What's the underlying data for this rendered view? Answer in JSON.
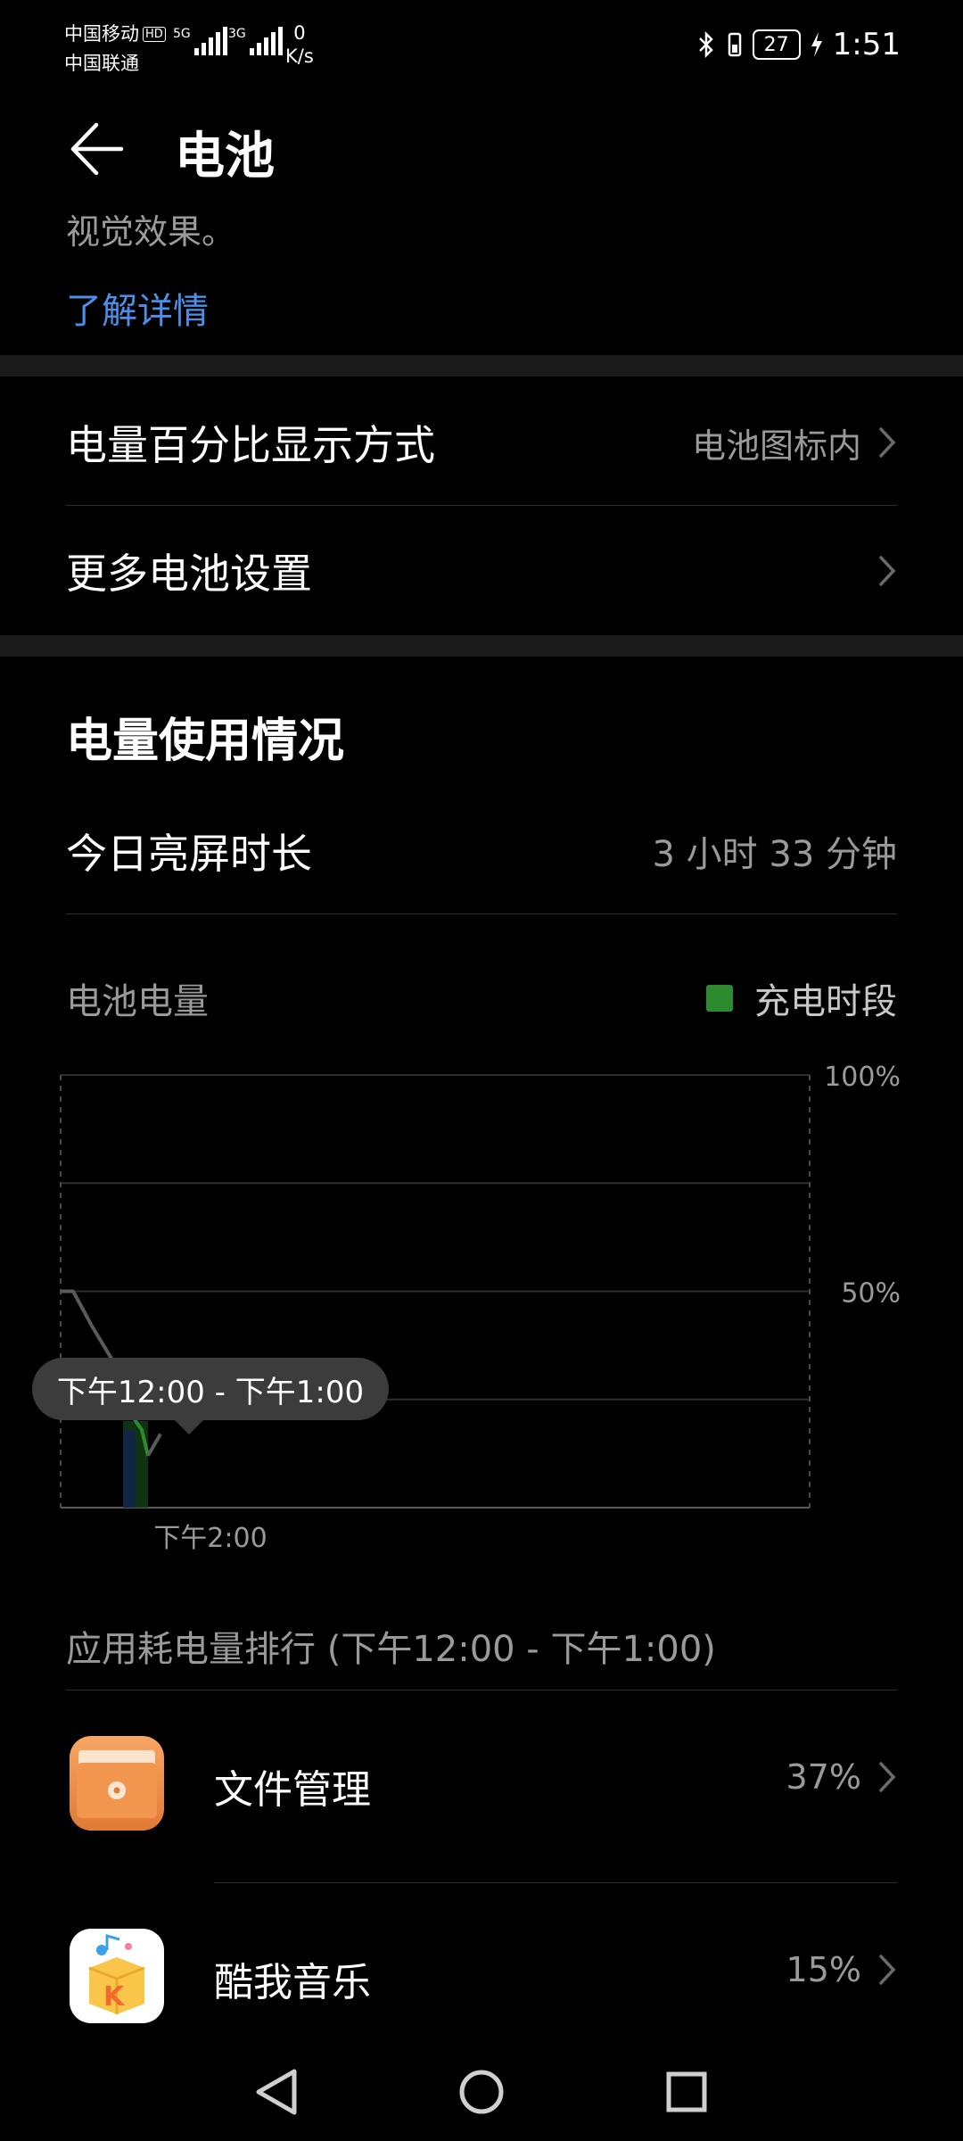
{
  "status_bar": {
    "carrier1": "中国移动",
    "carrier1_badge": "HD",
    "carrier2": "中国联通",
    "sig1_tag": "5G",
    "sig2_tag": "3G",
    "speed_value": "0",
    "speed_unit": "K/s",
    "battery_level": "27",
    "time": "1:51"
  },
  "header": {
    "title": "电池"
  },
  "intro": {
    "cut_text": "视觉效果。",
    "learn_more": "了解详情"
  },
  "settings": {
    "percent_display_label": "电量百分比显示方式",
    "percent_display_value": "电池图标内",
    "more_settings_label": "更多电池设置"
  },
  "usage": {
    "section_title": "电量使用情况",
    "screen_on_label": "今日亮屏时长",
    "screen_on_value": "3 小时 33 分钟"
  },
  "chart_data": {
    "type": "line",
    "title": "电池电量",
    "legend": "充电时段",
    "ylim": [
      0,
      100
    ],
    "y_ticks": [
      "100%",
      "50%"
    ],
    "x_ticks": [
      "下午2:00"
    ],
    "selected_range": "下午12:00 - 下午1:00",
    "series": [
      {
        "x": [
          0.0,
          0.2,
          0.5,
          1.0,
          1.1,
          1.2,
          1.3,
          1.4,
          1.6
        ],
        "values": [
          50,
          50,
          42,
          30,
          24,
          20,
          18,
          12,
          17
        ]
      }
    ],
    "charging_color": "#2e8a2e",
    "selected_color": "#3a7be0"
  },
  "ranking": {
    "title": "应用耗电量排行 (下午12:00 - 下午1:00)",
    "apps": [
      {
        "name": "文件管理",
        "percent": "37%",
        "icon": "folder-app-icon"
      },
      {
        "name": "酷我音乐",
        "percent": "15%",
        "icon": "music-app-icon"
      }
    ]
  }
}
